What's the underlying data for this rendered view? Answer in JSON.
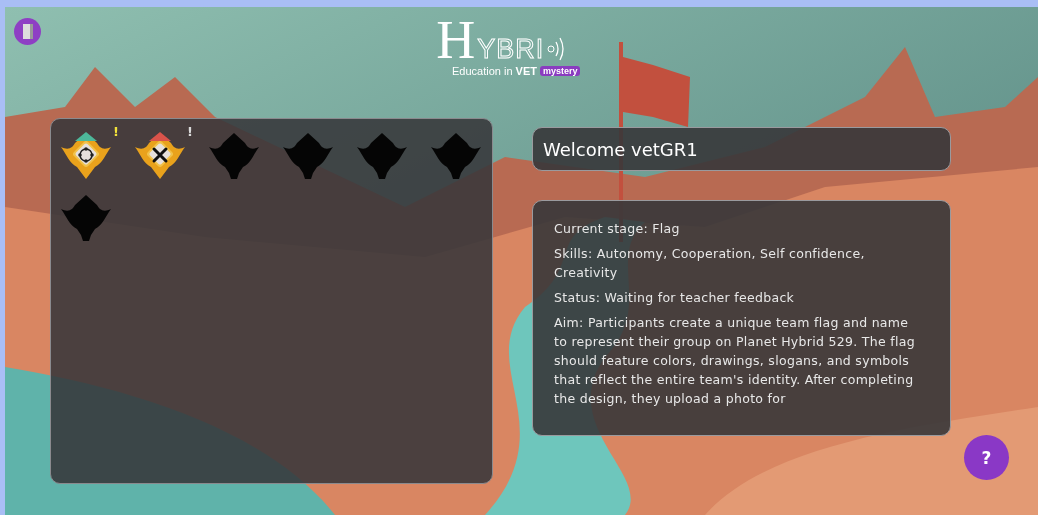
{
  "logo": {
    "initial": "H",
    "word": "YBRI",
    "tagline": "Education in",
    "tagline_bold": "VET",
    "tag": "mystery"
  },
  "badges": [
    {
      "kind": "team",
      "alert": "!",
      "color": "#f2e23a"
    },
    {
      "kind": "tools",
      "alert": "!",
      "color": "#d9d9d9"
    },
    {
      "kind": "locked"
    },
    {
      "kind": "locked"
    },
    {
      "kind": "locked"
    },
    {
      "kind": "locked"
    },
    {
      "kind": "locked"
    }
  ],
  "welcome": "Welcome vetGR1",
  "info": {
    "stage": "Current stage: Flag",
    "skills": "Skills: Autonomy, Cooperation, Self confidence, Creativity",
    "status": "Status: Waiting for teacher feedback",
    "aim": "Aim: Participants create a unique team flag and name to represent their group on Planet Hybrid 529. The flag should feature colors, drawings, slogans, and symbols that reflect the entire team's identity. After completing the design, they upload a photo for"
  },
  "help_button": "?"
}
